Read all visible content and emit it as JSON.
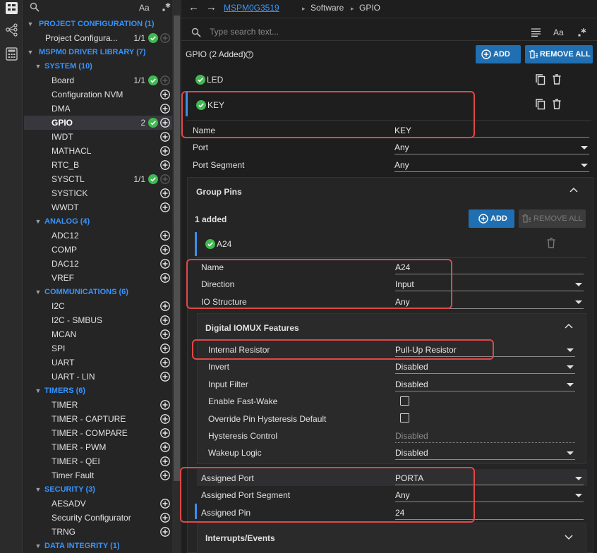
{
  "colors": {
    "accent": "#3794ff",
    "ok": "#3fb950",
    "highlight": "#e04848",
    "button": "#1f6fb2"
  },
  "activity": [
    "explorer-icon",
    "hierarchy-icon",
    "calculator-icon"
  ],
  "sidebar": {
    "search_icon": "search-icon",
    "match_case_label": "Aa",
    "regex_icon": "regex-icon",
    "tree": [
      {
        "kind": "cat",
        "label": "PROJECT CONFIGURATION (1)"
      },
      {
        "kind": "item",
        "label": "Project Configura...",
        "count": "1/1",
        "ok": true,
        "plus_disabled": true
      },
      {
        "kind": "cat",
        "label": "MSPM0 DRIVER LIBRARY (7)"
      },
      {
        "kind": "sub",
        "label": "SYSTEM (10)"
      },
      {
        "kind": "item",
        "label": "Board",
        "count": "1/1",
        "ok": true,
        "plus_disabled": true
      },
      {
        "kind": "item",
        "label": "Configuration NVM"
      },
      {
        "kind": "item",
        "label": "DMA"
      },
      {
        "kind": "item",
        "label": "GPIO",
        "count": "2",
        "ok": true,
        "selected": true
      },
      {
        "kind": "item",
        "label": "IWDT"
      },
      {
        "kind": "item",
        "label": "MATHACL"
      },
      {
        "kind": "item",
        "label": "RTC_B"
      },
      {
        "kind": "item",
        "label": "SYSCTL",
        "count": "1/1",
        "ok": true,
        "plus_disabled": true
      },
      {
        "kind": "item",
        "label": "SYSTICK"
      },
      {
        "kind": "item",
        "label": "WWDT"
      },
      {
        "kind": "sub",
        "label": "ANALOG (4)"
      },
      {
        "kind": "item",
        "label": "ADC12"
      },
      {
        "kind": "item",
        "label": "COMP"
      },
      {
        "kind": "item",
        "label": "DAC12"
      },
      {
        "kind": "item",
        "label": "VREF"
      },
      {
        "kind": "sub",
        "label": "COMMUNICATIONS (6)"
      },
      {
        "kind": "item",
        "label": "I2C"
      },
      {
        "kind": "item",
        "label": "I2C - SMBUS"
      },
      {
        "kind": "item",
        "label": "MCAN"
      },
      {
        "kind": "item",
        "label": "SPI"
      },
      {
        "kind": "item",
        "label": "UART"
      },
      {
        "kind": "item",
        "label": "UART - LIN"
      },
      {
        "kind": "sub",
        "label": "TIMERS (6)"
      },
      {
        "kind": "item",
        "label": "TIMER"
      },
      {
        "kind": "item",
        "label": "TIMER - CAPTURE"
      },
      {
        "kind": "item",
        "label": "TIMER - COMPARE"
      },
      {
        "kind": "item",
        "label": "TIMER - PWM"
      },
      {
        "kind": "item",
        "label": "TIMER - QEI"
      },
      {
        "kind": "item",
        "label": "Timer Fault"
      },
      {
        "kind": "sub",
        "label": "SECURITY (3)"
      },
      {
        "kind": "item",
        "label": "AESADV"
      },
      {
        "kind": "item",
        "label": "Security Configurator"
      },
      {
        "kind": "item",
        "label": "TRNG"
      },
      {
        "kind": "sub",
        "label": "DATA INTEGRITY (1)"
      }
    ]
  },
  "breadcrumb": {
    "device": "MSPM0G3519",
    "sep": "▸",
    "software": "Software",
    "current": "GPIO"
  },
  "main_search": {
    "placeholder": "Type search text...",
    "match_case_label": "Aa"
  },
  "gpio": {
    "title": "GPIO (2 Added)",
    "help_icon": "help-icon",
    "add_label": "ADD",
    "remove_all_label": "REMOVE ALL",
    "instances": [
      "LED",
      "KEY"
    ],
    "fields": {
      "name_label": "Name",
      "name_value": "KEY",
      "port_label": "Port",
      "port_value": "Any",
      "segment_label": "Port Segment",
      "segment_value": "Any"
    }
  },
  "group_pins": {
    "title": "Group Pins",
    "added": "1 added",
    "add_label": "ADD",
    "remove_all_label": "REMOVE ALL",
    "pin": "A24",
    "fields": {
      "name_label": "Name",
      "name_value": "A24",
      "direction_label": "Direction",
      "direction_value": "Input",
      "io_label": "IO Structure",
      "io_value": "Any"
    }
  },
  "iomux": {
    "title": "Digital IOMUX Features",
    "internal_resistor_label": "Internal Resistor",
    "internal_resistor_value": "Pull-Up Resistor",
    "invert_label": "Invert",
    "invert_value": "Disabled",
    "input_filter_label": "Input Filter",
    "input_filter_value": "Disabled",
    "fast_wake_label": "Enable Fast-Wake",
    "fast_wake_checked": false,
    "override_label": "Override Pin Hysteresis Default",
    "override_checked": false,
    "hysteresis_label": "Hysteresis Control",
    "hysteresis_value": "Disabled",
    "wakeup_label": "Wakeup Logic",
    "wakeup_value": "Disabled"
  },
  "assigned": {
    "port_label": "Assigned Port",
    "port_value": "PORTA",
    "segment_label": "Assigned Port Segment",
    "segment_value": "Any",
    "pin_label": "Assigned Pin",
    "pin_value": "24"
  },
  "interrupts": {
    "title": "Interrupts/Events"
  }
}
